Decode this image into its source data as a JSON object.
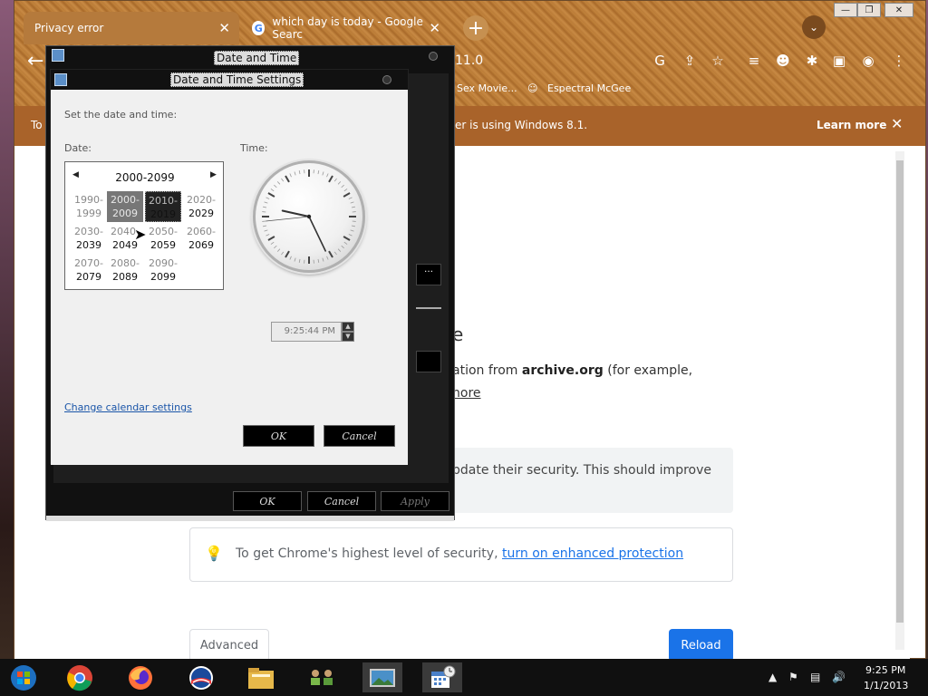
{
  "browser": {
    "tabs": [
      {
        "label": "Privacy error"
      },
      {
        "label": "which day is today - Google Searc"
      }
    ],
    "omnibox_text": "11.0",
    "bookmarks": [
      {
        "label": "Sex Movie..."
      },
      {
        "label": "Espectral McGee"
      }
    ],
    "infobar": {
      "prefix": "To",
      "text": "er is using Windows 8.1.",
      "learn_more": "Learn more"
    },
    "page": {
      "heading_fragment": "e",
      "para1_pre": "ation from ",
      "para1_bold": "archive.org",
      "para1_post": " (for example,",
      "para2": "nore",
      "gray_box_text": "pdate their security. This should improve",
      "security_text": "To get Chrome's highest level of security, ",
      "security_link": "turn on enhanced protection",
      "advanced_label": "Advanced",
      "reload_label": "Reload"
    }
  },
  "date_time_dialog": {
    "title": "Date and Time",
    "ok_label": "OK",
    "cancel_label": "Cancel",
    "apply_label": "Apply"
  },
  "date_time_settings": {
    "title": "Date and Time Settings",
    "heading": "Set the date and time:",
    "date_label": "Date:",
    "time_label": "Time:",
    "calendar": {
      "title": "2000-2099",
      "decades": [
        {
          "a": "1990-",
          "b": "1999",
          "state": "dim"
        },
        {
          "a": "2000-",
          "b": "2009",
          "state": "sel"
        },
        {
          "a": "2010-",
          "b": "2019",
          "state": "cur"
        },
        {
          "a": "2020-",
          "b": "2029",
          "state": ""
        },
        {
          "a": "2030-",
          "b": "2039",
          "state": ""
        },
        {
          "a": "2040-",
          "b": "2049",
          "state": ""
        },
        {
          "a": "2050-",
          "b": "2059",
          "state": ""
        },
        {
          "a": "2060-",
          "b": "2069",
          "state": ""
        },
        {
          "a": "2070-",
          "b": "2079",
          "state": ""
        },
        {
          "a": "2080-",
          "b": "2089",
          "state": ""
        },
        {
          "a": "2090-",
          "b": "2099",
          "state": ""
        }
      ]
    },
    "time_value": "9:25:44 PM",
    "clock": {
      "hour": 9,
      "minute": 25,
      "second": 44
    },
    "change_calendar_link": "Change calendar settings",
    "ok_label": "OK",
    "cancel_label": "Cancel"
  },
  "taskbar": {
    "time": "9:25 PM",
    "date": "1/1/2013"
  }
}
